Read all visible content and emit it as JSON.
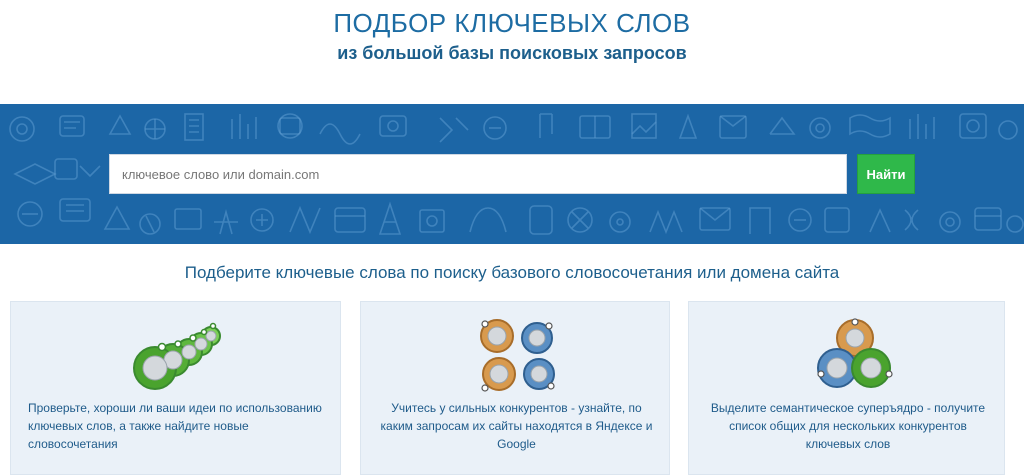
{
  "header": {
    "title": "ПОДБОР КЛЮЧЕВЫХ СЛОВ",
    "subtitle": "из большой базы поисковых запросов"
  },
  "search": {
    "placeholder": "ключевое слово или domain.com",
    "value": "",
    "button_label": "Найти"
  },
  "section": {
    "heading": "Подберите ключевые слова по поиску базового словосочетания или домена сайта"
  },
  "cards": [
    {
      "text": "Проверьте, хороши ли ваши идеи по использованию ключевых слов, а также найдите новые словосочетания",
      "icon": "green-tags-icon"
    },
    {
      "text": "Учитесь у сильных конкурентов - узнайте, по каким запросам их сайты находятся в Яндексе и Google",
      "icon": "blue-orange-tags-icon"
    },
    {
      "text": "Выделите семантическое суперъядро - получите список общих для нескольких конкурентов ключевых слов",
      "icon": "overlapping-tags-icon"
    }
  ],
  "colors": {
    "band": "#1c66a6",
    "button": "#2fb84a",
    "card": "#eaf1f8",
    "text": "#1d5f8c"
  }
}
